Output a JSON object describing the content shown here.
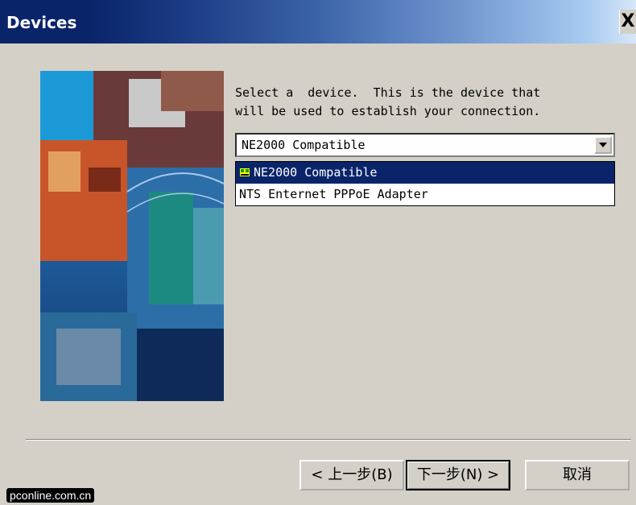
{
  "window": {
    "title": "Devices",
    "close_label": "X"
  },
  "instruction": "Select a  device.  This is the device that\nwill be used to establish your connection.",
  "device_select": {
    "selected": "NE2000 Compatible"
  },
  "device_options": [
    {
      "label": "NE2000 Compatible",
      "icon": "network-adapter-icon",
      "selected": true
    },
    {
      "label": "NTS Enternet PPPoE Adapter",
      "selected": false
    }
  ],
  "buttons": {
    "back": "< 上一步(B)",
    "next": "下一步(N) >",
    "cancel": "取消"
  },
  "watermark": "pconline.com.cn"
}
